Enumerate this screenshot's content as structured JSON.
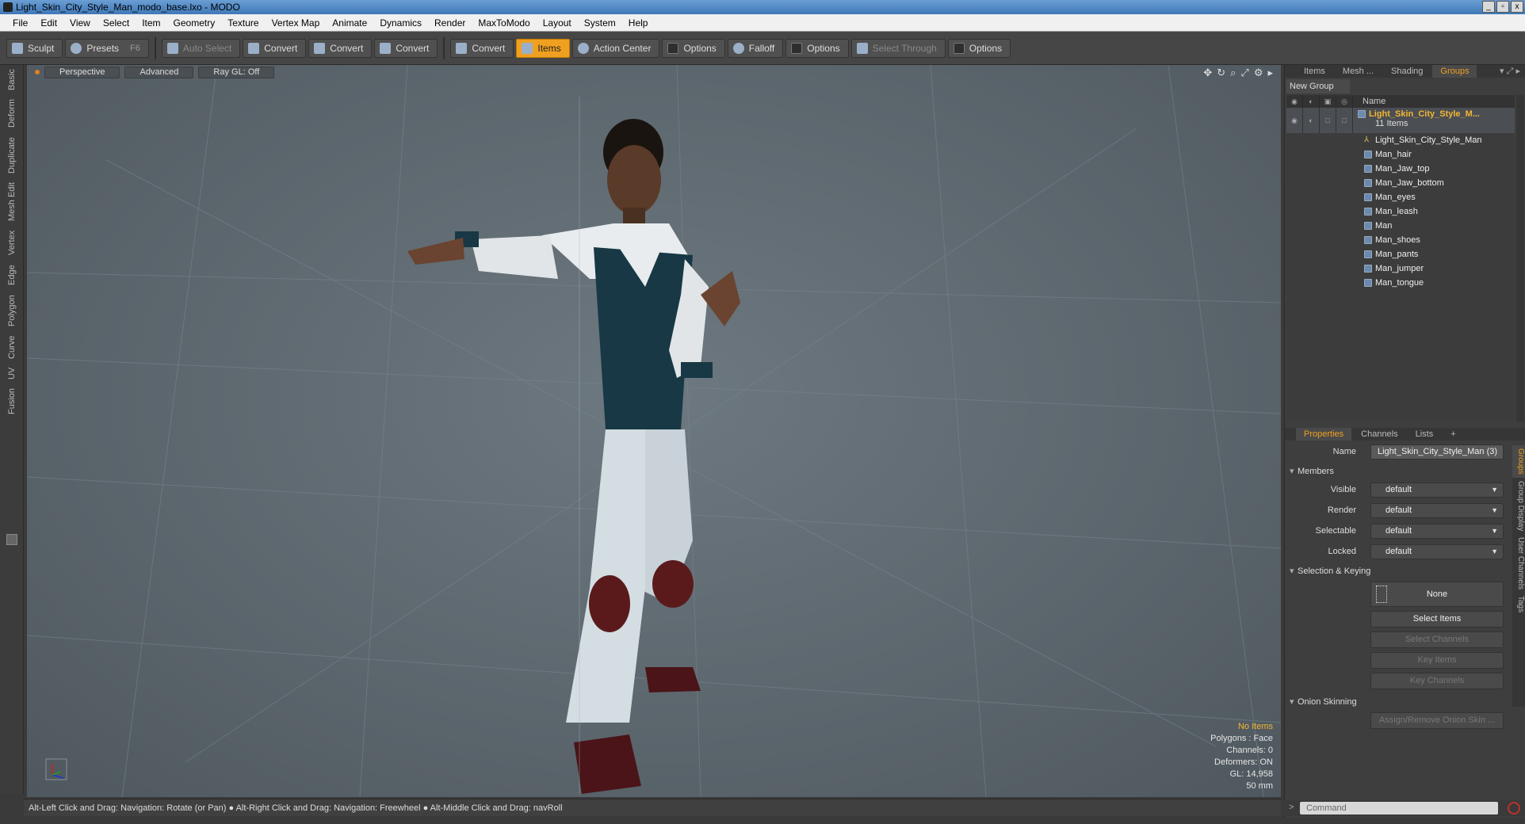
{
  "window": {
    "title": "Light_Skin_City_Style_Man_modo_base.lxo - MODO",
    "controls": [
      "_",
      "▫",
      "x"
    ]
  },
  "menu": [
    "File",
    "Edit",
    "View",
    "Select",
    "Item",
    "Geometry",
    "Texture",
    "Vertex Map",
    "Animate",
    "Dynamics",
    "Render",
    "MaxToModo",
    "Layout",
    "System",
    "Help"
  ],
  "toolbar": {
    "sculpt": "Sculpt",
    "presets": "Presets",
    "presets_key": "F6",
    "auto_select": "Auto Select",
    "convert1": "Convert",
    "convert2": "Convert",
    "convert3": "Convert",
    "convert4": "Convert",
    "items": "Items",
    "action_center": "Action Center",
    "options1": "Options",
    "falloff": "Falloff",
    "options2": "Options",
    "select_through": "Select Through",
    "options3": "Options"
  },
  "left_tabs": [
    "Basic",
    "Deform",
    "Duplicate",
    "Mesh Edit",
    "Vertex",
    "Edge",
    "Polygon",
    "Curve",
    "UV",
    "Fusion"
  ],
  "viewport": {
    "tabs": [
      "Perspective",
      "Advanced",
      "Ray GL: Off"
    ],
    "info": {
      "selection": "No Items",
      "polygons": "Polygons : Face",
      "channels": "Channels: 0",
      "deformers": "Deformers: ON",
      "gl": "GL: 14,958",
      "scale": "50 mm"
    }
  },
  "statusbar": "Alt-Left Click and Drag: Navigation: Rotate (or Pan) ● Alt-Right Click and Drag: Navigation: Freewheel ● Alt-Middle Click and Drag: navRoll",
  "right_panel": {
    "tabs": [
      "Items",
      "Mesh ...",
      "Shading",
      "Groups"
    ],
    "active_tab": "Groups",
    "new_group": "New Group",
    "name_header": "Name",
    "group": {
      "name": "Light_Skin_City_Style_M...",
      "count": "11 Items"
    },
    "items": [
      "Light_Skin_City_Style_Man",
      "Man_hair",
      "Man_Jaw_top",
      "Man_Jaw_bottom",
      "Man_eyes",
      "Man_leash",
      "Man",
      "Man_shoes",
      "Man_pants",
      "Man_jumper",
      "Man_tongue"
    ],
    "prop_tabs": [
      "Properties",
      "Channels",
      "Lists",
      "+"
    ],
    "properties": {
      "name_label": "Name",
      "name_value": "Light_Skin_City_Style_Man (3)",
      "members_section": "Members",
      "visible_label": "Visible",
      "visible_value": "default",
      "render_label": "Render",
      "render_value": "default",
      "selectable_label": "Selectable",
      "selectable_value": "default",
      "locked_label": "Locked",
      "locked_value": "default",
      "selection_section": "Selection & Keying",
      "none_btn": "None",
      "select_items": "Select Items",
      "select_channels": "Select Channels",
      "key_items": "Key Items",
      "key_channels": "Key Channels",
      "onion_section": "Onion Skinning",
      "onion_btn": "Assign/Remove Onion Skin ..."
    },
    "side_tabs": [
      "Groups",
      "Group Display",
      "User Channels",
      "Tags"
    ]
  },
  "command": {
    "prompt": ">",
    "placeholder": "Command"
  }
}
